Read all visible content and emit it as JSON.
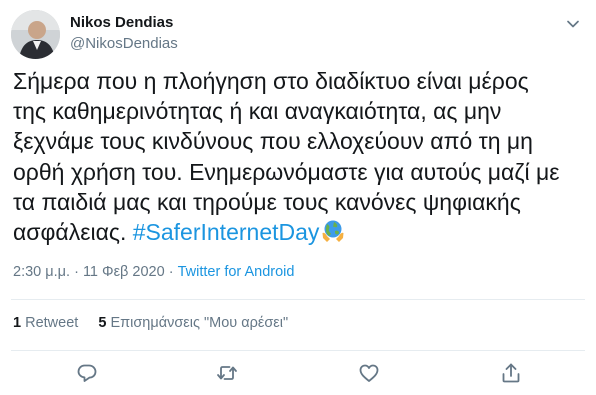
{
  "tweet": {
    "author_name": "Nikos Dendias",
    "author_handle": "@NikosDendias",
    "text": "Σήμερα που η πλοήγηση στο διαδίκτυο είναι μέρος\nτης καθημερινότητας ή και αναγκαιότητα, ας μην\nξεχνάμε τους κινδύνους που ελλοχεύουν από τη μη\nορθή χρήση του. Ενημερωνόμαστε για αυτούς μαζί με\nτα παιδιά μας και τηρούμε τους κανόνες ψηφιακής\nασφάλειας. ",
    "hashtag": "#SaferInternetDay",
    "emoji": "globe-in-hands-icon",
    "time": "2:30 μ.μ.",
    "separator": "·",
    "date": "11 Φεβ 2020",
    "source": "Twitter for Android",
    "retweets_count": "1",
    "retweets_label": "Retweet",
    "likes_count": "5",
    "likes_label": "Επισημάνσεις \"Μου αρέσει\""
  },
  "icons": {
    "menu": "chevron-down-icon",
    "reply": "reply-icon",
    "retweet": "retweet-icon",
    "like": "heart-icon",
    "share": "share-icon"
  },
  "colors": {
    "link": "#1b95e0",
    "secondary": "#657786",
    "text": "#14171a"
  }
}
